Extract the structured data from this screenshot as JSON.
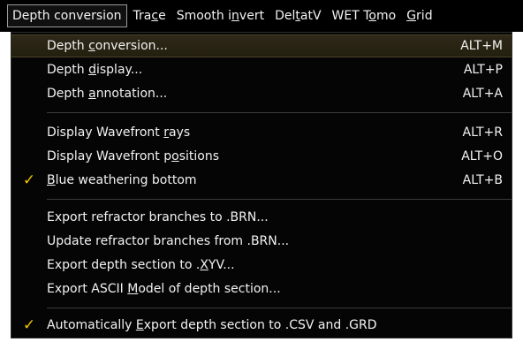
{
  "menubar": {
    "items": [
      {
        "pre": "Depth conversion",
        "u": "",
        "post": ""
      },
      {
        "pre": "Tra",
        "u": "c",
        "post": "e"
      },
      {
        "pre": "Smooth i",
        "u": "n",
        "post": "vert"
      },
      {
        "pre": "Del",
        "u": "t",
        "post": "atV"
      },
      {
        "pre": "WET T",
        "u": "o",
        "post": "mo"
      },
      {
        "pre": "",
        "u": "G",
        "post": "rid"
      }
    ]
  },
  "menu": {
    "items": [
      {
        "pre": "Depth ",
        "u": "c",
        "post": "onversion...",
        "shortcut": "ALT+M",
        "checked": false
      },
      {
        "pre": "Depth ",
        "u": "d",
        "post": "isplay...",
        "shortcut": "ALT+P",
        "checked": false
      },
      {
        "pre": "Depth ",
        "u": "a",
        "post": "nnotation...",
        "shortcut": "ALT+A",
        "checked": false
      },
      {
        "pre": "Display Wavefront ",
        "u": "r",
        "post": "ays",
        "shortcut": "ALT+R",
        "checked": false
      },
      {
        "pre": "Display Wavefront p",
        "u": "o",
        "post": "sitions",
        "shortcut": "ALT+O",
        "checked": false
      },
      {
        "pre": "",
        "u": "B",
        "post": "lue weathering bottom",
        "shortcut": "ALT+B",
        "checked": true
      },
      {
        "pre": "Export refractor branches to .BRN...",
        "u": "",
        "post": "",
        "shortcut": "",
        "checked": false
      },
      {
        "pre": "Update refractor branches from .BRN...",
        "u": "",
        "post": "",
        "shortcut": "",
        "checked": false
      },
      {
        "pre": "Export depth section to .",
        "u": "X",
        "post": "YV...",
        "shortcut": "",
        "checked": false
      },
      {
        "pre": "Export ASCII ",
        "u": "M",
        "post": "odel of depth section...",
        "shortcut": "",
        "checked": false
      },
      {
        "pre": "Automatically ",
        "u": "E",
        "post": "xport depth section to .CSV and .GRD",
        "shortcut": "",
        "checked": true
      }
    ],
    "check_glyph": "✓"
  }
}
